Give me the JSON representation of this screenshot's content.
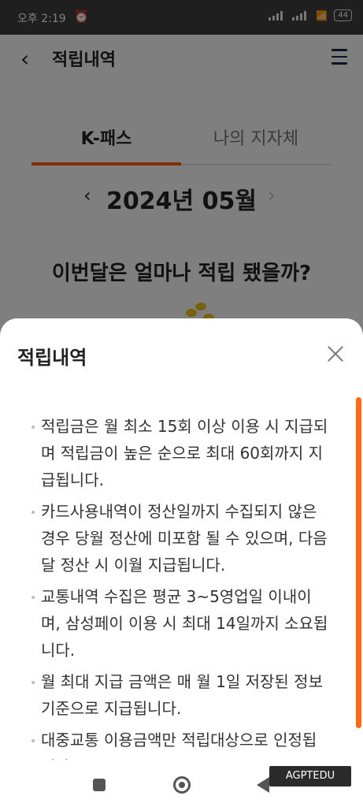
{
  "status_bar": {
    "time": "오후 2:19",
    "battery": "44"
  },
  "header": {
    "title": "적립내역"
  },
  "tabs": [
    {
      "label": "K-패스"
    },
    {
      "label": "나의 지자체"
    }
  ],
  "month": {
    "label": "2024년 05월"
  },
  "question": "이번달은 얼마나 적립 됐을까?",
  "sheet": {
    "title": "적립내역",
    "notes": [
      "적립금은 월 최소 15회 이상 이용 시 지급되며 적립금이 높은 순으로 최대 60회까지 지급됩니다.",
      "카드사용내역이 정산일까지 수집되지 않은 경우 당월 정산에 미포함 될 수 있으며, 다음달 정산 시 이월 지급됩니다.",
      "교통내역 수집은 평균 3~5영업일 이내이며, 삼성페이 이용 시 최대 14일까지 소요됩니다.",
      "월 최대 지급 금액은 매 월 1일 저장된 정보 기준으로 지급됩니다.",
      "대중교통 이용금액만 적립대상으로 인정됩니다."
    ]
  },
  "watermark": "AGPTEDU",
  "colors": {
    "accent": "#ff5a00",
    "dim": "rgba(0,0,0,0.5)"
  }
}
